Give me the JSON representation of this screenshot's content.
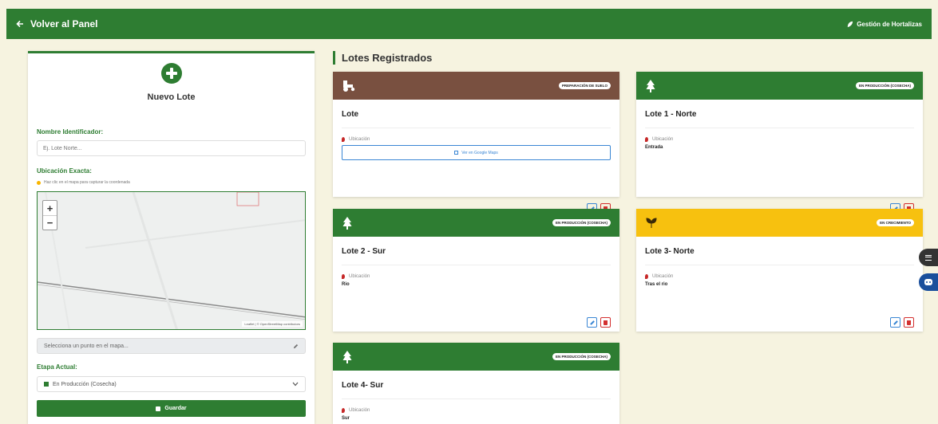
{
  "topbar": {
    "back_label": "Volver al Panel",
    "brand_label": "Gestión de Hortalizas"
  },
  "form": {
    "title": "Nuevo Lote",
    "name_label": "Nombre Identificador:",
    "name_placeholder": "Ej. Lote Norte...",
    "location_label": "Ubicación Exacta:",
    "location_hint": "Haz clic en el mapa para capturar la coordenada",
    "map_attribution": "Leaflet | © OpenStreetMap contributors",
    "coord_placeholder": "Selecciona un punto en el mapa...",
    "stage_label": "Etapa Actual:",
    "stage_value": "En Producción (Cosecha)",
    "save_label": "Guardar"
  },
  "section_title": "Lotes Registrados",
  "lots": [
    {
      "name": "Lote",
      "stage": "PREPARACIÓN DE SUELO",
      "location_label": "Ubicación",
      "maps_link": "Ver en Google Maps",
      "header_color": "#795040",
      "icon": "tractor-icon"
    },
    {
      "name": "Lote 1 - Norte",
      "stage": "EN PRODUCCIÓN (COSECHA)",
      "location_label": "Ubicación",
      "location": "Entrada",
      "header_color": "#2e7d32",
      "icon": "tree-icon"
    },
    {
      "name": "Lote 2 - Sur",
      "stage": "EN PRODUCCIÓN (COSECHA)",
      "location_label": "Ubicación",
      "location": "Rio",
      "header_color": "#2e7d32",
      "icon": "tree-icon"
    },
    {
      "name": "Lote 3- Norte",
      "stage": "EN CRECIMIENTO",
      "location_label": "Ubicación",
      "location": "Tras el rio",
      "header_color": "#f7c10f",
      "icon": "seedling-icon"
    },
    {
      "name": "Lote 4- Sur",
      "stage": "EN PRODUCCIÓN (COSECHA)",
      "location_label": "Ubicación",
      "location": "Sur",
      "header_color": "#2e7d32",
      "icon": "tree-icon"
    }
  ]
}
